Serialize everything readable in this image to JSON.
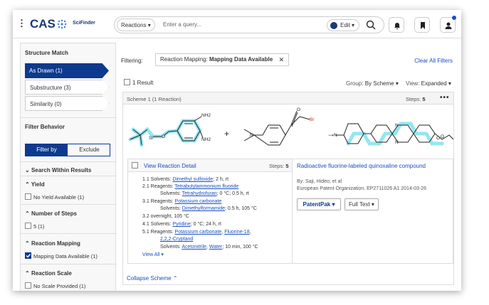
{
  "header": {
    "brand": "CAS",
    "product": "SciFinder",
    "search_type": "Reactions ▾",
    "search_placeholder": "Enter a query...",
    "edit_label": "Edit ▾"
  },
  "sidebar": {
    "structure_match_title": "Structure Match",
    "structure_options": [
      "As Drawn (1)",
      "Substructure (3)",
      "Similarity (0)"
    ],
    "filter_behavior_title": "Filter Behavior",
    "filter_by": "Filter by",
    "exclude": "Exclude",
    "search_within": "Search Within Results",
    "yield_title": "Yield",
    "yield_option": "No Yield Available (1)",
    "steps_title": "Number of Steps",
    "steps_option": "5 (1)",
    "mapping_title": "Reaction Mapping",
    "mapping_option": "Mapping Data Available (1)",
    "scale_title": "Reaction Scale",
    "scale_option": "No Scale Provided (1)"
  },
  "main": {
    "filtering_label": "Filtering:",
    "chip_prefix": "Reaction Mapping: ",
    "chip_value": "Mapping Data Available",
    "clear_all": "Clear All Filters",
    "result_count": "1 Result",
    "group_label": "Group:",
    "group_value": "By Scheme ▾",
    "view_label": "View:",
    "view_value": "Expanded ▾"
  },
  "scheme": {
    "label": "Scheme 1",
    "count": "(1 Reaction)",
    "steps_label": "Steps:",
    "steps_value": "5",
    "more": "•••",
    "view_detail": "View Reaction Detail",
    "detail_steps_label": "Steps:",
    "detail_steps_value": "5",
    "lines": [
      [
        "1.1 Solvents: ",
        "Dimethyl sulfoxide",
        "; 2 h, rt"
      ],
      [
        "2.1 Reagents: ",
        "Tetrabutylammonium fluoride",
        ""
      ],
      [
        "Solvents: ",
        "Tetrahydrofuran",
        "; 0 °C; 0.5 h, rt"
      ],
      [
        "3.1 Reagents: ",
        "Potassium carbonate",
        ""
      ],
      [
        "Solvents: ",
        "Dimethylformamide",
        "; 0.5 h, 105 °C"
      ],
      [
        "3.2 overnight, 105 °C",
        "",
        ""
      ],
      [
        "4.1 Solvents: ",
        "Pyridine",
        "; 0 °C; 24 h, rt"
      ],
      [
        "5.1 Reagents: ",
        "Potassium carbonate",
        ", "
      ],
      [
        "",
        "2,2,2-Cryptand",
        ""
      ],
      [
        "Solvents: ",
        "Acetonitrile",
        ", "
      ]
    ],
    "line8_extra": "Fluorine-18",
    "line10_extra": "Water",
    "line10_tail": "; 10 min, 100 °C",
    "view_all": "View All ▾",
    "ref_title": "Radioactive fluorine-labeled quinoxaline compound",
    "ref_authors": "By: Saji, Hideo; et al",
    "ref_source": "European Patent Organization, EP2711026 A1 2014-03-26",
    "patentpak": "PatentPak ▾",
    "fulltext": "Full Text ▾",
    "collapse": "Collapse Scheme ⌃",
    "atom_labels": [
      "Si",
      "O",
      "NH2",
      "NH2",
      "N",
      "O",
      "Br",
      "N",
      "N",
      "N",
      "O",
      "O"
    ],
    "plus": "+",
    "arrow": "→"
  },
  "colors": {
    "brand": "#0d3a8e",
    "highlight": "#3ecfe8",
    "link": "#1b4fbf"
  }
}
